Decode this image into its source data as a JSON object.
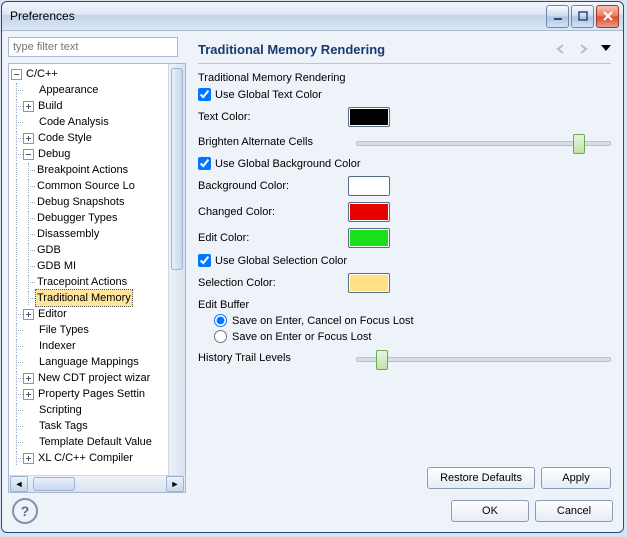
{
  "window": {
    "title": "Preferences"
  },
  "filter": {
    "placeholder": "type filter text"
  },
  "tree": {
    "root": "C/C++",
    "items": {
      "appearance": "Appearance",
      "build": "Build",
      "code_analysis": "Code Analysis",
      "code_style": "Code Style",
      "debug": "Debug",
      "breakpoint_actions": "Breakpoint Actions",
      "common_source": "Common Source Lo",
      "debug_snapshots": "Debug Snapshots",
      "debugger_types": "Debugger Types",
      "disassembly": "Disassembly",
      "gdb": "GDB",
      "gdb_mi": "GDB MI",
      "tracepoint_actions": "Tracepoint Actions",
      "traditional_memory": "Traditional Memory",
      "editor": "Editor",
      "file_types": "File Types",
      "indexer": "Indexer",
      "language_mappings": "Language Mappings",
      "new_cdt": "New CDT project wizar",
      "property_pages": "Property Pages Settin",
      "scripting": "Scripting",
      "task_tags": "Task Tags",
      "template_defaults": "Template Default Value",
      "xl_compiler": "XL C/C++ Compiler"
    }
  },
  "page": {
    "title": "Traditional Memory Rendering",
    "section": "Traditional Memory Rendering",
    "use_global_text": "Use Global Text Color",
    "text_color_label": "Text Color:",
    "brighten_label": "Brighten Alternate Cells",
    "use_global_bg": "Use Global Background Color",
    "bg_color_label": "Background Color:",
    "changed_color_label": "Changed Color:",
    "edit_color_label": "Edit Color:",
    "use_global_sel": "Use Global Selection Color",
    "sel_color_label": "Selection Color:",
    "edit_buffer": "Edit Buffer",
    "radio_save_cancel": "Save on Enter, Cancel on Focus Lost",
    "radio_save_either": "Save on Enter or Focus Lost",
    "history_label": "History Trail Levels"
  },
  "colors": {
    "text": "#000000",
    "background": "#ffffff",
    "changed": "#e60000",
    "edit": "#19e019",
    "selection": "#ffe082"
  },
  "sliders": {
    "brighten_pos_pct": 85,
    "history_pos_pct": 8
  },
  "buttons": {
    "restore": "Restore Defaults",
    "apply": "Apply",
    "ok": "OK",
    "cancel": "Cancel"
  }
}
